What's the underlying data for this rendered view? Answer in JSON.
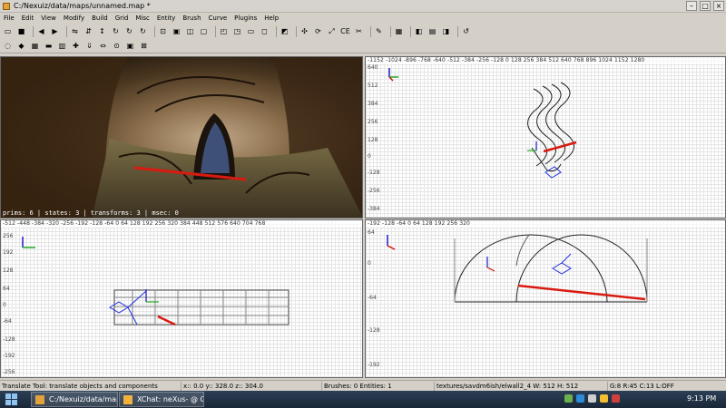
{
  "window": {
    "title": "C:/Nexuiz/data/maps/unnamed.map *",
    "controls": [
      "minimize",
      "maximize",
      "close"
    ]
  },
  "menu": [
    "File",
    "Edit",
    "View",
    "Modify",
    "Build",
    "Grid",
    "Misc",
    "Entity",
    "Brush",
    "Curve",
    "Plugins",
    "Help"
  ],
  "toolbar1": {
    "items": [
      {
        "name": "open-icon",
        "glyph": "▭"
      },
      {
        "name": "save-icon",
        "glyph": "■"
      },
      {
        "name": "sep"
      },
      {
        "name": "undo-icon",
        "glyph": "◀"
      },
      {
        "name": "redo-icon",
        "glyph": "▶"
      },
      {
        "name": "sep"
      },
      {
        "name": "flip-x-icon",
        "glyph": "⇋"
      },
      {
        "name": "flip-y-icon",
        "glyph": "⇵"
      },
      {
        "name": "flip-z-icon",
        "glyph": "↕"
      },
      {
        "name": "rotate-x-icon",
        "glyph": "↻"
      },
      {
        "name": "rotate-y-icon",
        "glyph": "↻"
      },
      {
        "name": "rotate-z-icon",
        "glyph": "↻"
      },
      {
        "name": "sep"
      },
      {
        "name": "select-touching-icon",
        "glyph": "⊡"
      },
      {
        "name": "select-inside-icon",
        "glyph": "▣"
      },
      {
        "name": "select-complete-tall-icon",
        "glyph": "◫"
      },
      {
        "name": "select-partial-tall-icon",
        "glyph": "▢"
      },
      {
        "name": "sep"
      },
      {
        "name": "csg-subtract-icon",
        "glyph": "◰"
      },
      {
        "name": "csg-merge-icon",
        "glyph": "◳"
      },
      {
        "name": "make-hollow-icon",
        "glyph": "▭"
      },
      {
        "name": "make-room-icon",
        "glyph": "◻"
      },
      {
        "name": "sep"
      },
      {
        "name": "change-views-icon",
        "glyph": "◩"
      },
      {
        "name": "sep"
      },
      {
        "name": "translate-icon",
        "glyph": "✣"
      },
      {
        "name": "rotate-icon",
        "glyph": "⟳"
      },
      {
        "name": "scale-icon",
        "glyph": "⤢"
      },
      {
        "name": "component-mode-icon",
        "glyph": "CE"
      },
      {
        "name": "clipper-icon",
        "glyph": "✂"
      },
      {
        "name": "sep"
      },
      {
        "name": "texture-lock-icon",
        "glyph": "✎"
      },
      {
        "name": "sep"
      },
      {
        "name": "patch-bend-icon",
        "glyph": "▦"
      },
      {
        "name": "sep"
      },
      {
        "name": "cubic-clip-icon",
        "glyph": "◧"
      },
      {
        "name": "texture-view-icon",
        "glyph": "▤"
      },
      {
        "name": "entity-view-icon",
        "glyph": "◨"
      },
      {
        "name": "sep"
      },
      {
        "name": "refresh-models-icon",
        "glyph": "↺"
      }
    ]
  },
  "toolbar2": {
    "items": [
      {
        "name": "bobtoolz-icon",
        "glyph": "◌"
      },
      {
        "name": "prefab-icon",
        "glyph": "◆"
      },
      {
        "name": "terrain-icon",
        "glyph": "▦"
      },
      {
        "name": "brush-split-icon",
        "glyph": "▬"
      },
      {
        "name": "merge-patches-icon",
        "glyph": "▥"
      },
      {
        "name": "vertex-icon",
        "glyph": "✚"
      },
      {
        "name": "pull-icon",
        "glyph": "⇓"
      },
      {
        "name": "mirror-icon",
        "glyph": "⇔"
      },
      {
        "name": "node-icon",
        "glyph": "⊙"
      },
      {
        "name": "caulk-icon",
        "glyph": "▣"
      },
      {
        "name": "clear-icon",
        "glyph": "⊠"
      }
    ]
  },
  "camera": {
    "status": "prims: 6 | states: 3 | transforms: 3 | msec: 0",
    "colors": {
      "rock_dark": "#3a2a1a",
      "rock_light": "#8a7458",
      "floor": "#6a6038",
      "sky": "#3a4a72",
      "highlight": "#d91a10"
    }
  },
  "viewports": {
    "top_right": {
      "ruler": "-1152 -1024 -896 -768 -640 -512 -384 -256 -128 0 128 256 384 512 640 768 896 1024 1152 1280",
      "left_labels": [
        "640",
        "512",
        "384",
        "256",
        "128",
        "0",
        "-128",
        "-256",
        "-384"
      ]
    },
    "bottom_left": {
      "ruler": "-512 -448 -384 -320 -256 -192 -128 -64 0 64 128 192 256 320 384 448 512 576 640 704 768",
      "left_labels": [
        "256",
        "192",
        "128",
        "64",
        "0",
        "-64",
        "-128",
        "-192",
        "-256"
      ]
    },
    "bottom_right": {
      "ruler": "-192 -128 -64 0 64 128 192 256 320",
      "left_labels": [
        "64",
        "0",
        "-64",
        "-128",
        "-192"
      ]
    }
  },
  "status": {
    "tool": "Translate Tool: translate objects and components",
    "coords": "x::   0.0  y:: 328.0  z:: 304.0",
    "counts": "Brushes: 0 Entities: 1",
    "texture": "textures/savdm6ish/elwall2_4 W: 512 H: 512",
    "grid": "G:8  R:45  C:13  L:OFF"
  },
  "taskbar": {
    "items": [
      {
        "label": "C:/Nexuiz/data/map...",
        "color": "#e2a23a"
      },
      {
        "label": "XChat: neXus- @ Qu...",
        "color": "#f2b03c"
      }
    ],
    "tray_colors": [
      "#6ab04c",
      "#2e8bd8",
      "#cfcfcf",
      "#f0c030",
      "#d04040"
    ],
    "time": "9:13 PM"
  }
}
